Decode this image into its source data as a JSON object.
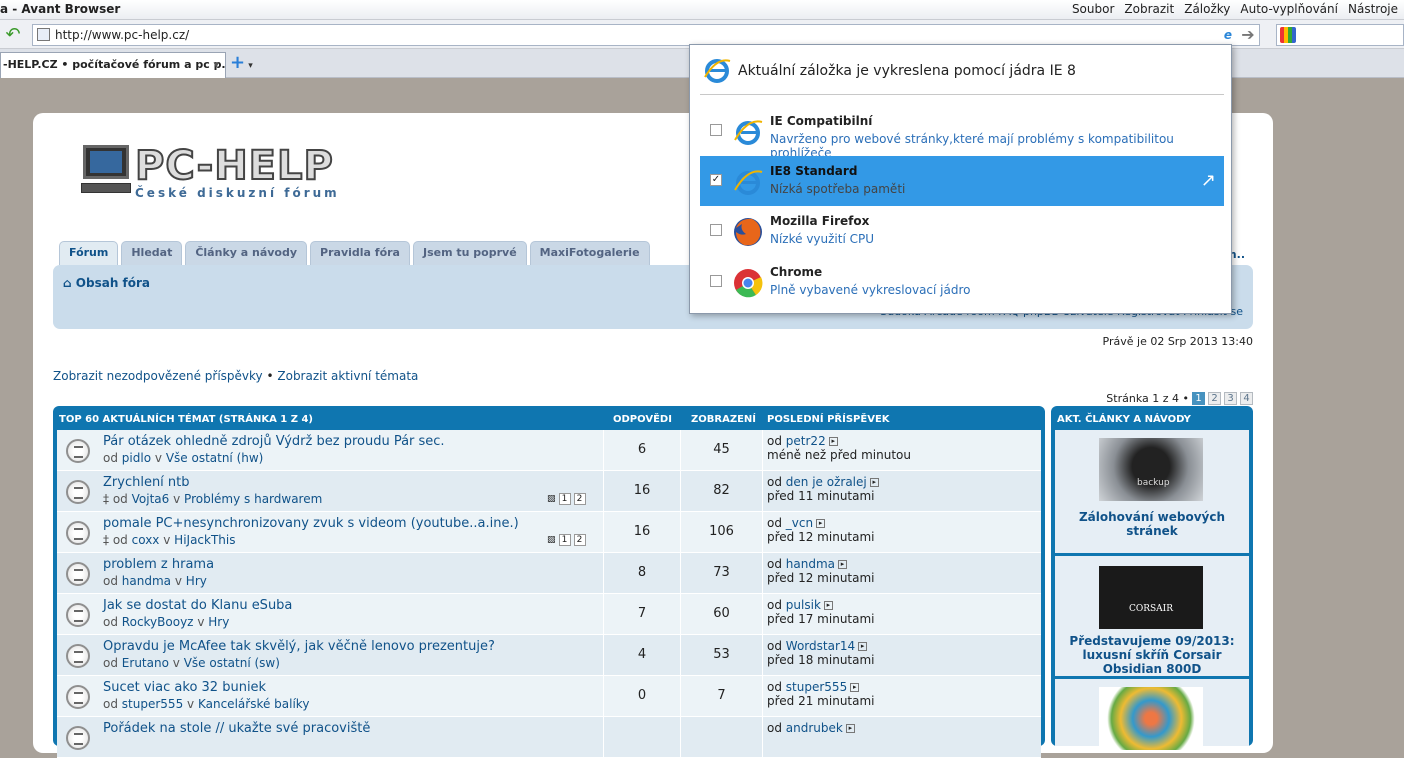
{
  "window": {
    "title": "a - Avant Browser"
  },
  "menu": [
    "Soubor",
    "Zobrazit",
    "Záložky",
    "Auto-vyplňování",
    "Nástroje"
  ],
  "address": {
    "url": "http://www.pc-help.cz/"
  },
  "tab": {
    "label": "-HELP.CZ • počítačové fórum a pc p..."
  },
  "logo": {
    "title": "PC-HELP",
    "subtitle": "České diskuzní fórum"
  },
  "navtabs": [
    "Fórum",
    "Hledat",
    "Články a návody",
    "Pravidla fóra",
    "Jsem tu poprvé",
    "MaxiFotogalerie"
  ],
  "navbar": {
    "home": "Obsah fóra",
    "right_fragment": "m..",
    "links": "Sudoku  Arcade room  FAQ phpBB  Uživatelé  Registrovat  Přihlásit se"
  },
  "date": "Právě je 02 Srp 2013 13:40",
  "viewlinks": {
    "unanswered": "Zobrazit nezodpovězené příspěvky",
    "sep": " • ",
    "active": "Zobrazit aktivní témata"
  },
  "pager": {
    "text": "Stránka 1 z 4 •",
    "pages": [
      "1",
      "2",
      "3",
      "4"
    ]
  },
  "forum": {
    "header": {
      "topic": "TOP 60 AKTUÁLNÍCH TÉMAT  (STRÁNKA 1 Z 4)",
      "replies": "ODPOVĚDI",
      "views": "ZOBRAZENÍ",
      "last": "POSLEDNÍ PŘÍSPĚVEK"
    },
    "rows": [
      {
        "title": "Pár otázek ohledně zdrojů Výdrž bez proudu Pár sec.",
        "by": "od",
        "author": "pidlo",
        "in": "v",
        "forum": "Vše ostatní (hw)",
        "replies": "6",
        "views": "45",
        "last_by": "od",
        "last_user": "petr22",
        "last_time": "méně než před minutou"
      },
      {
        "title": "Zrychlení ntb",
        "by": "od",
        "author": "Vojta6",
        "in": "v",
        "forum": "Problémy s hardwarem",
        "replies": "16",
        "views": "82",
        "last_by": "od",
        "last_user": "den je ožralej",
        "last_time": "před 11 minutami",
        "pages": [
          "1",
          "2"
        ]
      },
      {
        "title": "pomale PC+nesynchronizovany zvuk s videom (youtube..a.ine.)",
        "by": "od",
        "author": "coxx",
        "in": "v",
        "forum": "HiJackThis",
        "replies": "16",
        "views": "106",
        "last_by": "od",
        "last_user": "_vcn",
        "last_time": "před 12 minutami",
        "pages": [
          "1",
          "2"
        ]
      },
      {
        "title": "problem z hrama",
        "by": "od",
        "author": "handma",
        "in": "v",
        "forum": "Hry",
        "replies": "8",
        "views": "73",
        "last_by": "od",
        "last_user": "handma",
        "last_time": "před 12 minutami"
      },
      {
        "title": "Jak se dostat do Klanu eSuba",
        "by": "od",
        "author": "RockyBooyz",
        "in": "v",
        "forum": "Hry",
        "replies": "7",
        "views": "60",
        "last_by": "od",
        "last_user": "pulsik",
        "last_time": "před 17 minutami"
      },
      {
        "title": "Opravdu je McAfee tak skvělý, jak věčně lenovo prezentuje?",
        "by": "od",
        "author": "Erutano",
        "in": "v",
        "forum": "Vše ostatní (sw)",
        "replies": "4",
        "views": "53",
        "last_by": "od",
        "last_user": "Wordstar14",
        "last_time": "před 18 minutami"
      },
      {
        "title": "Sucet viac ako 32 buniek",
        "by": "od",
        "author": "stuper555",
        "in": "v",
        "forum": "Kancelářské balíky",
        "replies": "0",
        "views": "7",
        "last_by": "od",
        "last_user": "stuper555",
        "last_time": "před 21 minutami"
      },
      {
        "title": "Pořádek na stole // ukažte své pracoviště",
        "by": "",
        "author": "",
        "in": "",
        "forum": "",
        "replies": "",
        "views": "",
        "last_by": "od",
        "last_user": "andrubek",
        "last_time": ""
      }
    ]
  },
  "side": {
    "header": "AKT. ČLÁNKY A NÁVODY",
    "articles": [
      {
        "caption": "Zálohování webových stránek",
        "img_label": "backup"
      },
      {
        "caption": "Představujeme 09/2013: luxusní skříň Corsair Obsidian 800D",
        "img_label": "CORSAIR"
      },
      {
        "caption": "",
        "img_label": ""
      }
    ]
  },
  "popup": {
    "header": "Aktuální záložka je vykreslena pomocí jádra IE 8",
    "options": [
      {
        "name": "IE Compatibilní",
        "desc": "Navrženo pro webové stránky,které mají problémy s kompatibilitou prohlížeče",
        "checked": false,
        "icon": "ie-icon"
      },
      {
        "name": "IE8 Standard",
        "desc": "Nízká spotřeba paměti",
        "checked": true,
        "icon": "ie-icon"
      },
      {
        "name": "Mozilla Firefox",
        "desc": "Nízké využití CPU",
        "checked": false,
        "icon": "firefox-icon"
      },
      {
        "name": "Chrome",
        "desc": "Plně vybavené vykreslovací jádro",
        "checked": false,
        "icon": "chrome-icon"
      }
    ]
  }
}
